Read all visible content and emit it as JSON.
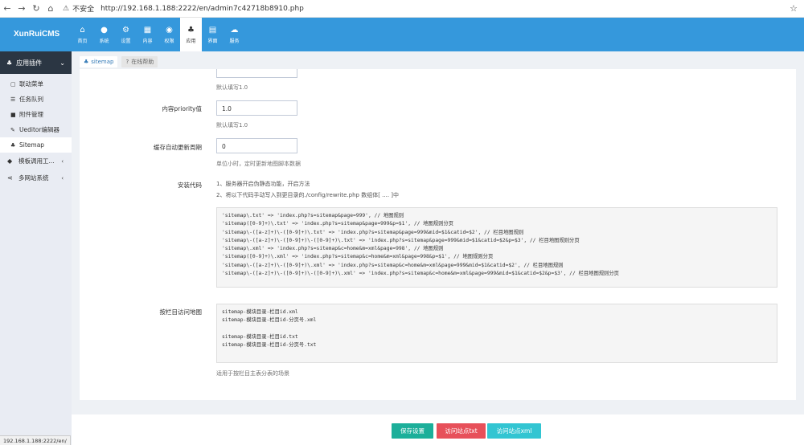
{
  "browser": {
    "security": "不安全",
    "url": "http://192.168.1.188:2222/en/admin7c42718b8910.php"
  },
  "logo": "XunRuiCMS",
  "topnav": [
    {
      "label": "首页",
      "icon": "home-icon"
    },
    {
      "label": "系统",
      "icon": "globe-icon"
    },
    {
      "label": "设置",
      "icon": "cogs-icon"
    },
    {
      "label": "内容",
      "icon": "th-icon"
    },
    {
      "label": "权限",
      "icon": "user-icon"
    },
    {
      "label": "应用",
      "icon": "plugin-icon"
    },
    {
      "label": "界面",
      "icon": "file-icon"
    },
    {
      "label": "服务",
      "icon": "cloud-icon"
    }
  ],
  "sidebar": {
    "head": "应用插件",
    "items": [
      {
        "label": "联动菜单",
        "icon": "window-icon"
      },
      {
        "label": "任务队列",
        "icon": "list-icon"
      },
      {
        "label": "附件管理",
        "icon": "folder-icon"
      },
      {
        "label": "Ueditor编辑器",
        "icon": "edit-icon"
      },
      {
        "label": "Sitemap",
        "icon": "sitemap-icon"
      }
    ],
    "groups": [
      {
        "label": "模板调用工...",
        "icon": "tag-icon"
      },
      {
        "label": "多网站系统",
        "icon": "share-icon"
      }
    ]
  },
  "tabs": [
    {
      "label": "sitemap",
      "icon": "sitemap-icon"
    },
    {
      "label": "在线帮助",
      "icon": "question-icon"
    }
  ],
  "form": {
    "help_top": "默认填写1.0",
    "priority_label": "内容priority值",
    "priority_value": "1.0",
    "priority_help": "默认填写1.0",
    "cache_label": "缓存自动更新周期",
    "cache_value": "0",
    "cache_help": "单位小时，定时更新地图脚本数据",
    "install_label": "安装代码",
    "install_line1": "1、服务器开启伪静态功能，开启方法",
    "install_line2": "2、将以下代码手动写入到更目录的./config/rewrite.php 数组体[ .... ]中",
    "code": "'sitemap\\.txt' => 'index.php?s=sitemap&page=999', // 地图规则\n'sitemap([0-9]+)\\.txt' => 'index.php?s=sitemap&page=999&p=$1', // 地图规则分页\n'sitemap\\-([a-z]+)\\-([0-9]+)\\.txt' => 'index.php?s=sitemap&page=999&mid=$1&catid=$2', // 栏目地图规则\n'sitemap\\-([a-z]+)\\-([0-9]+)\\-([0-9]+)\\.txt' => 'index.php?s=sitemap&page=999&mid=$1&catid=$2&p=$3', // 栏目地图规则分页\n'sitemap\\.xml' => 'index.php?s=sitemap&c=home&m=xml&page=998', // 地图规则\n'sitemap([0-9]+)\\.xml' => 'index.php?s=sitemap&c=home&m=xml&page=998&p=$1', // 地图规则分页\n'sitemap\\-([a-z]+)\\-([0-9]+)\\.xml' => 'index.php?s=sitemap&c=home&m=xml&page=999&mid=$1&catid=$2', // 栏目地图规则\n'sitemap\\-([a-z]+)\\-([0-9]+)\\-([0-9]+)\\.xml' => 'index.php?s=sitemap&c=home&m=xml&page=999&mid=$1&catid=$2&p=$3', // 栏目地图规则分页",
    "catmap_label": "按栏目访问地图",
    "catmap_code": "sitemap-模块目录-栏目id.xml\nsitemap-模块目录-栏目id-分页号.xml\n\nsitemap-模块目录-栏目id.txt\nsitemap-模块目录-栏目id-分页号.txt",
    "catmap_help": "适用于按栏目主表分表的场景"
  },
  "buttons": {
    "save": "保存设置",
    "txt": "访问站点txt",
    "xml": "访问站点xml"
  },
  "colors": {
    "topnav": "#3598dc",
    "save": "#1caf9a",
    "txt": "#e7505a",
    "xml": "#32c5d2"
  },
  "statusbar": "192.168.1.188:2222/en/"
}
